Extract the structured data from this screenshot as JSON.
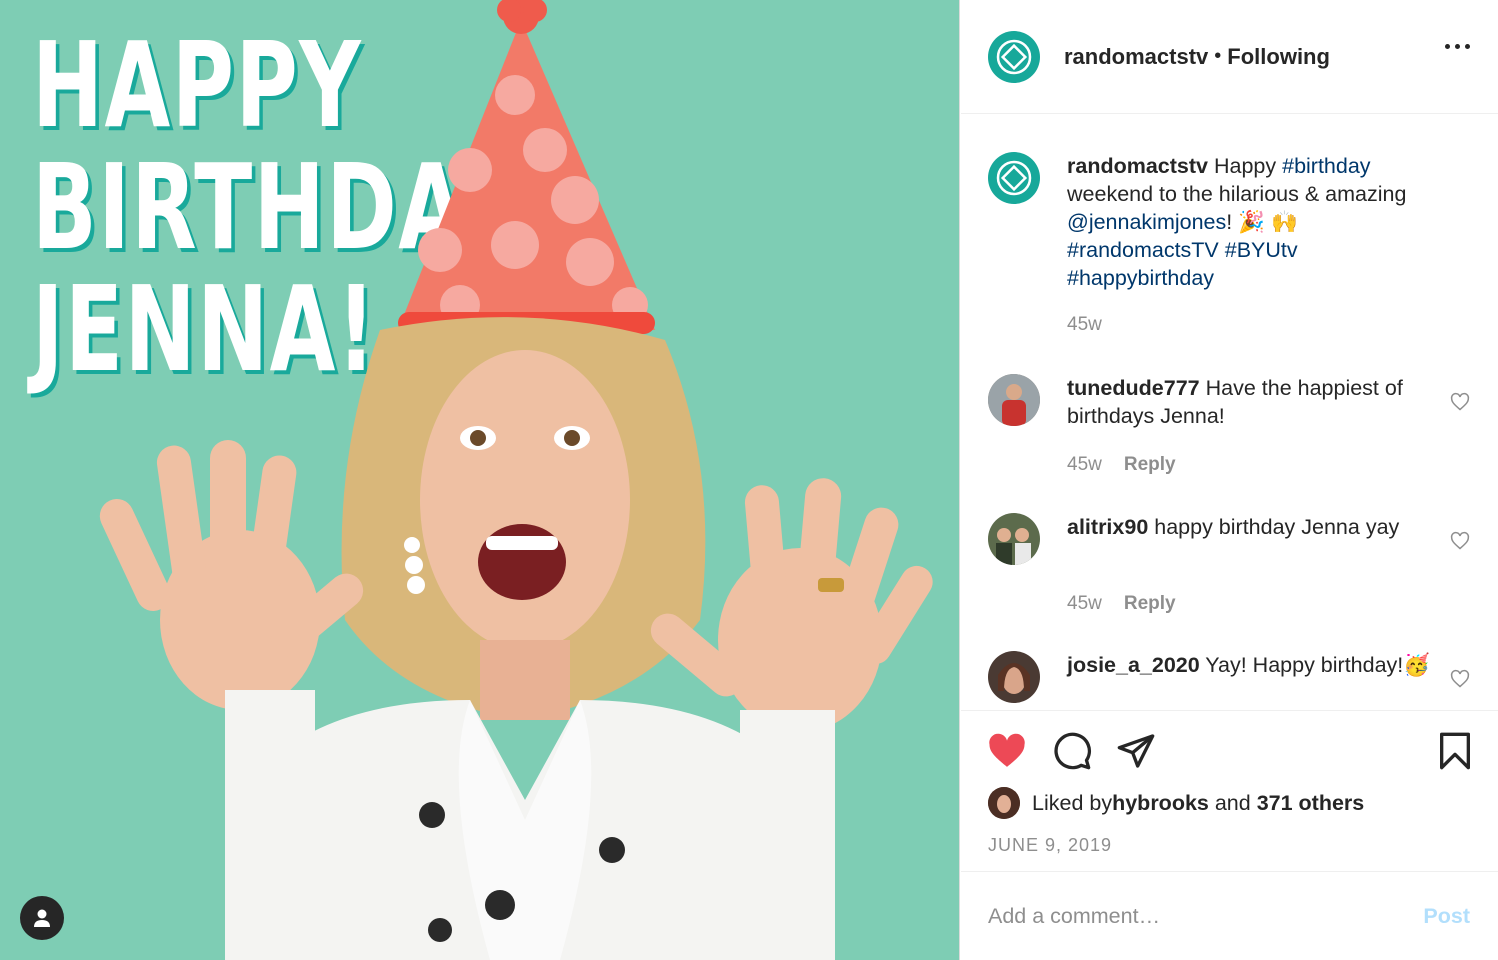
{
  "image": {
    "headline": [
      "HAPPY",
      "BIRTHDAY",
      "JENNA!"
    ],
    "background_color": "#7ecdb4",
    "tag_icon": "user-icon"
  },
  "header": {
    "username": "randomactstv",
    "separator": "•",
    "follow_status": "Following",
    "avatar_icon": "ra-logo-icon",
    "more_icon": "more-options-icon"
  },
  "caption": {
    "username": "randomactstv",
    "text_parts": [
      {
        "t": " Happy ",
        "tag": false
      },
      {
        "t": "#birthday",
        "tag": true
      },
      {
        "t": " weekend to the hilarious & amazing ",
        "tag": false
      },
      {
        "t": "@jennakimjones",
        "tag": true
      },
      {
        "t": "! 🎉 🙌 ",
        "tag": false
      },
      {
        "t": "#randomactsTV",
        "tag": true
      },
      {
        "t": " ",
        "tag": false
      },
      {
        "t": "#BYUtv",
        "tag": true
      },
      {
        "t": " ",
        "tag": false
      },
      {
        "t": "#happybirthday",
        "tag": true
      }
    ],
    "time": "45w"
  },
  "comments": [
    {
      "username": "tunedude777",
      "text": " Have the happiest of birthdays Jenna!",
      "time": "45w",
      "reply": "Reply"
    },
    {
      "username": "alitrix90",
      "text": " happy birthday Jenna yay",
      "time": "45w",
      "reply": "Reply"
    },
    {
      "username": "josie_a_2020",
      "text": " Yay! Happy birthday!🥳",
      "time": "",
      "reply": ""
    }
  ],
  "actions": {
    "like_icon": "heart-filled-icon",
    "comment_icon": "comment-icon",
    "share_icon": "share-icon",
    "save_icon": "bookmark-icon",
    "like_color": "#ed4956"
  },
  "likes": {
    "prefix": "Liked by ",
    "user": "hybrooks",
    "middle": " and ",
    "others": "371 others"
  },
  "date": "JUNE 9, 2019",
  "comment_box": {
    "placeholder": "Add a comment…",
    "post_label": "Post"
  }
}
